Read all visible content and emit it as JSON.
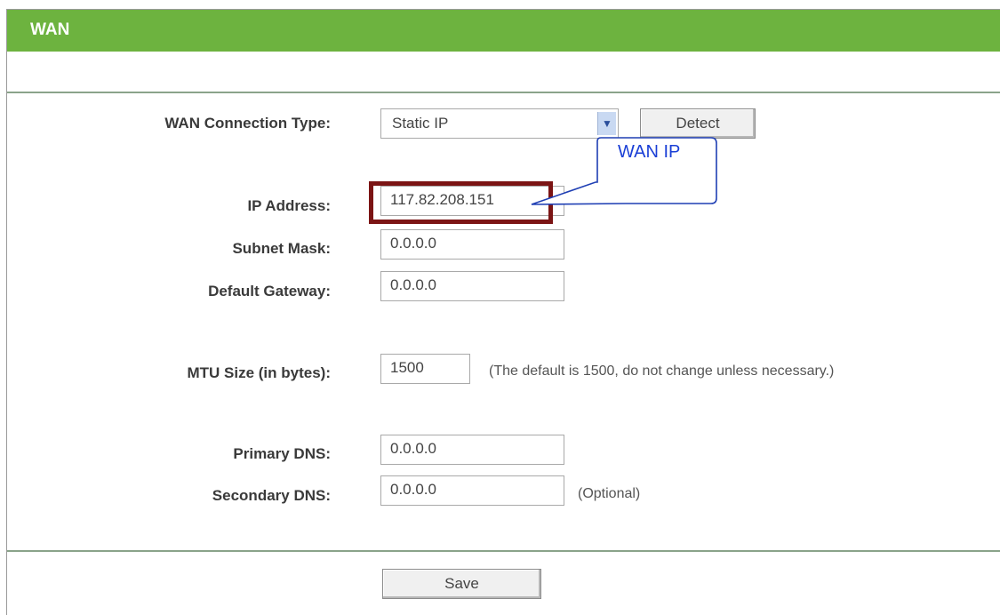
{
  "panel": {
    "title": "WAN"
  },
  "form": {
    "connection_type_label": "WAN Connection Type:",
    "connection_type_value": "Static IP",
    "detect_label": "Detect",
    "ip_address_label": "IP Address:",
    "ip_address_value": "117.82.208.151",
    "subnet_mask_label": "Subnet Mask:",
    "subnet_mask_value": "0.0.0.0",
    "default_gateway_label": "Default Gateway:",
    "default_gateway_value": "0.0.0.0",
    "mtu_label": "MTU Size (in bytes):",
    "mtu_value": "1500",
    "mtu_hint": "(The default is 1500, do not change unless necessary.)",
    "primary_dns_label": "Primary DNS:",
    "primary_dns_value": "0.0.0.0",
    "secondary_dns_label": "Secondary DNS:",
    "secondary_dns_value": "0.0.0.0",
    "optional_hint": "(Optional)",
    "save_label": "Save"
  },
  "annotation": {
    "callout_text": "WAN IP",
    "highlight_color": "#7b1414",
    "callout_color": "#1a3fd6"
  },
  "colors": {
    "title_bar": "#6db33f"
  },
  "icons": {
    "dropdown": "chevron-down-icon"
  }
}
